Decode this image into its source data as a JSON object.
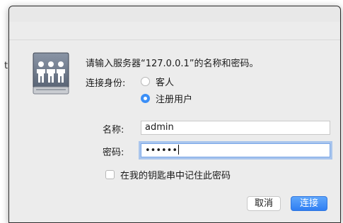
{
  "dialog": {
    "prompt": "请输入服务器“127.0.0.1”的名称和密码。",
    "connect_as_label": "连接身份:",
    "radio_options": [
      {
        "label": "客人",
        "selected": false
      },
      {
        "label": "注册用户",
        "selected": true
      }
    ],
    "name_label": "名称:",
    "name_value": "admin",
    "password_label": "密码:",
    "password_masked": "••••••",
    "remember_label": "在我的钥匙串中记住此密码",
    "remember_checked": false,
    "cancel_label": "取消",
    "connect_label": "连接"
  },
  "background": {
    "glyph": "t"
  },
  "icon": "server-users-icon",
  "colors": {
    "accent": "#3b8ff7",
    "dialog_bg": "#ececec",
    "focus_ring": "#5896f0"
  }
}
